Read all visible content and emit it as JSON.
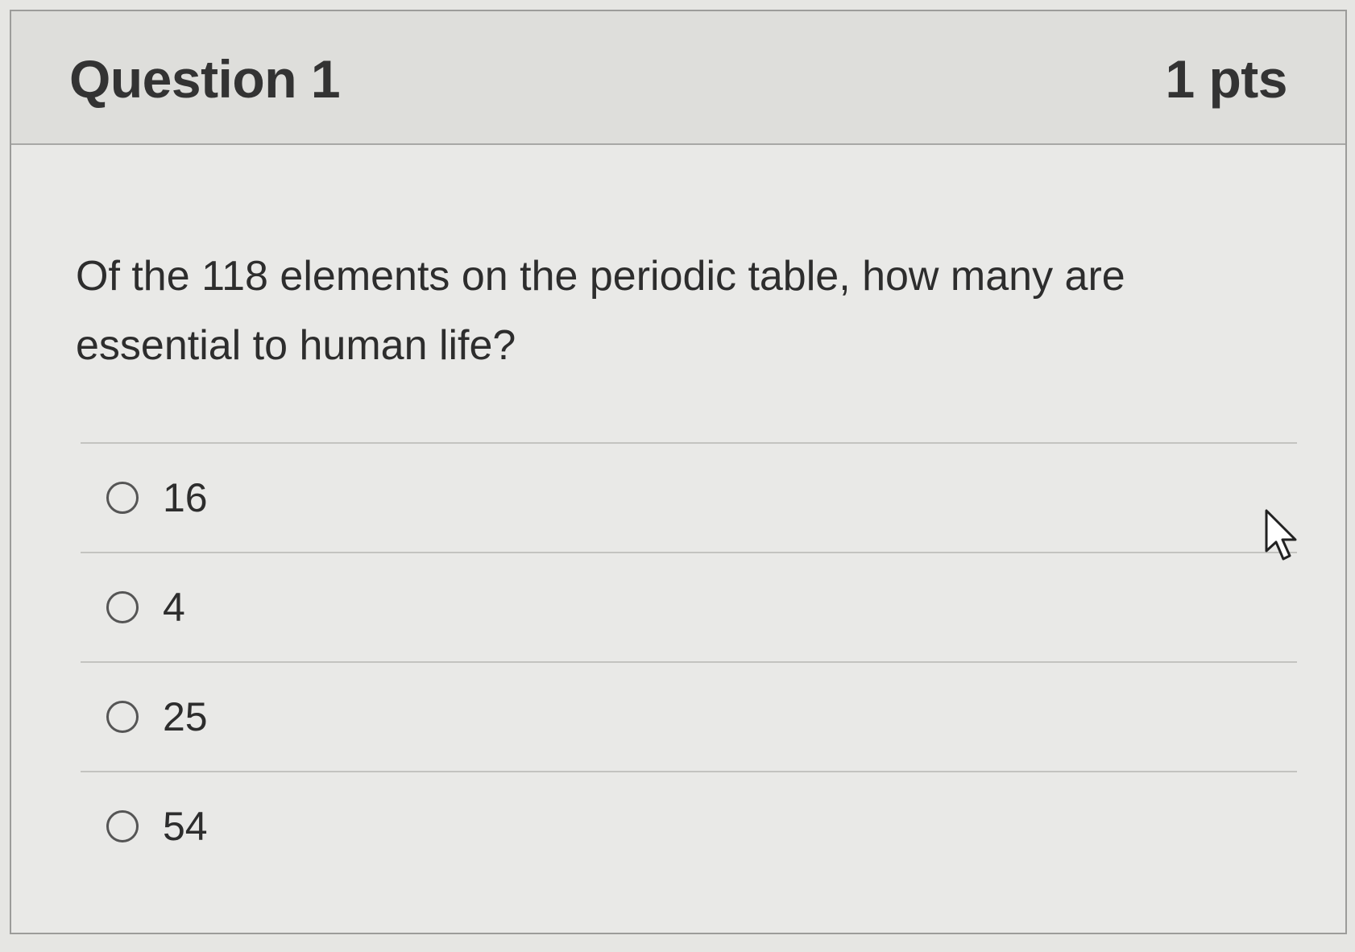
{
  "question": {
    "title": "Question 1",
    "points": "1 pts",
    "text": "Of the 118 elements on the periodic table, how many are essential to human life?"
  },
  "answers": [
    {
      "label": "16",
      "selected": false
    },
    {
      "label": "4",
      "selected": false
    },
    {
      "label": "25",
      "selected": false
    },
    {
      "label": "54",
      "selected": false
    }
  ],
  "icons": {
    "radio": "radio-unchecked-icon",
    "cursor": "mouse-pointer-icon"
  }
}
